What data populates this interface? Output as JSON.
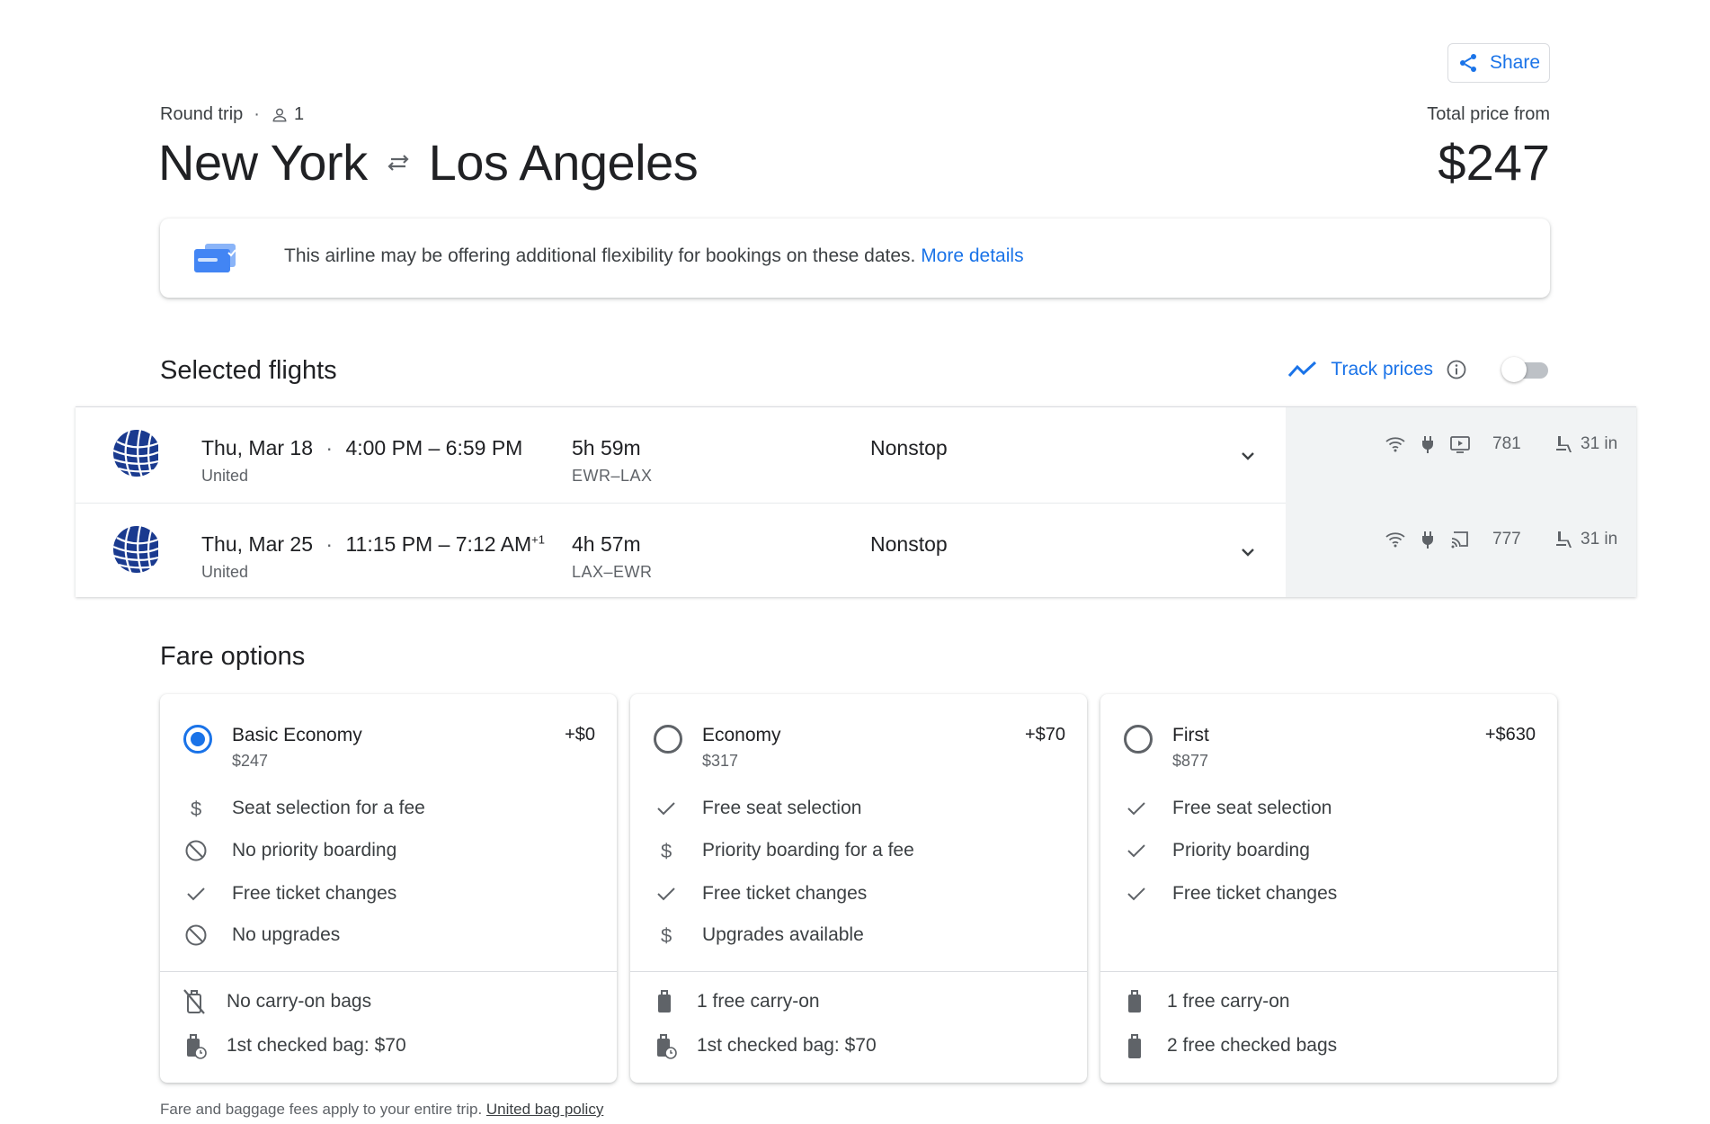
{
  "header": {
    "share_label": "Share",
    "trip_type": "Round trip",
    "separator": "·",
    "passengers": "1",
    "origin": "New York",
    "destination": "Los Angeles",
    "total_label": "Total price from",
    "total_price": "$247"
  },
  "notice": {
    "text": "This airline may be offering additional flexibility for bookings on these dates.",
    "link": "More details"
  },
  "selected": {
    "title": "Selected flights",
    "track_label": "Track prices",
    "track_enabled": false,
    "flights": [
      {
        "date": "Thu, Mar 18",
        "sep": "·",
        "times": "4:00 PM – 6:59 PM",
        "plus_days": "",
        "airline": "United",
        "duration": "5h 59m",
        "codes": "EWR–LAX",
        "stops": "Nonstop",
        "aircraft": "781",
        "legroom": "31 in",
        "icons": [
          "wifi-icon",
          "power-outlet-icon",
          "video-screen-icon"
        ]
      },
      {
        "date": "Thu, Mar 25",
        "sep": "·",
        "times": "11:15 PM – 7:12 AM",
        "plus_days": "+1",
        "airline": "United",
        "duration": "4h 57m",
        "codes": "LAX–EWR",
        "stops": "Nonstop",
        "aircraft": "777",
        "legroom": "31 in",
        "icons": [
          "wifi-icon",
          "power-outlet-icon",
          "cast-icon"
        ]
      }
    ]
  },
  "fares": {
    "title": "Fare options",
    "options": [
      {
        "name": "Basic Economy",
        "price": "$247",
        "add": "+$0",
        "selected": true,
        "features": [
          "Seat selection for a fee",
          "No priority boarding",
          "Free ticket changes",
          "No upgrades"
        ],
        "bags": [
          "No carry-on bags",
          "1st checked bag: $70"
        ]
      },
      {
        "name": "Economy",
        "price": "$317",
        "add": "+$70",
        "selected": false,
        "features": [
          "Free seat selection",
          "Priority boarding for a fee",
          "Free ticket changes",
          "Upgrades available"
        ],
        "bags": [
          "1 free carry-on",
          "1st checked bag: $70"
        ]
      },
      {
        "name": "First",
        "price": "$877",
        "add": "+$630",
        "selected": false,
        "features": [
          "Free seat selection",
          "Priority boarding",
          "Free ticket changes"
        ],
        "bags": [
          "1 free carry-on",
          "2 free checked bags"
        ]
      }
    ]
  },
  "footer": {
    "text": "Fare and baggage fees apply to your entire trip.",
    "link": "United bag policy"
  },
  "colors": {
    "accent": "#1a73e8",
    "text": "#202124",
    "muted": "#5f6368",
    "amenity_panel": "#f1f3f4"
  }
}
